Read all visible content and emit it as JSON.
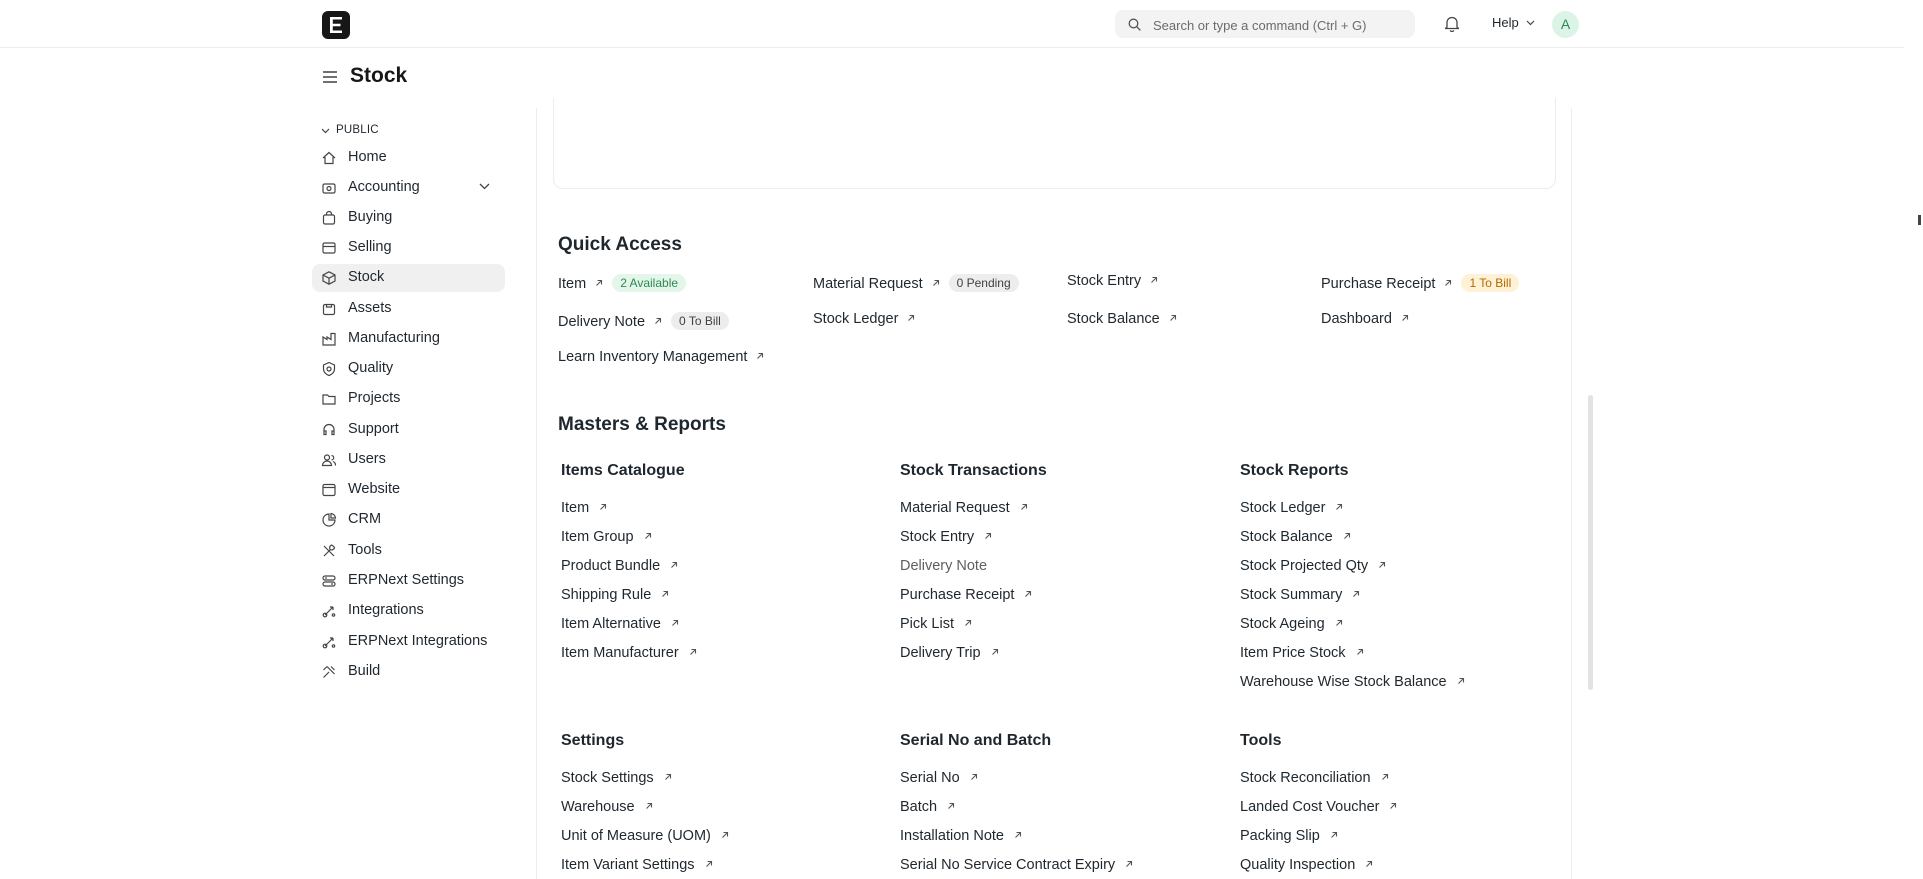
{
  "navbar": {
    "search_placeholder": "Search or type a command (Ctrl + G)",
    "help_label": "Help",
    "avatar_initial": "A"
  },
  "page": {
    "title": "Stock"
  },
  "sidebar": {
    "section_label": "PUBLIC",
    "items": [
      {
        "label": "Home",
        "icon": "home-icon"
      },
      {
        "label": "Accounting",
        "icon": "accounting-icon",
        "expandable": true
      },
      {
        "label": "Buying",
        "icon": "buying-icon"
      },
      {
        "label": "Selling",
        "icon": "selling-icon"
      },
      {
        "label": "Stock",
        "icon": "stock-icon",
        "active": true
      },
      {
        "label": "Assets",
        "icon": "assets-icon"
      },
      {
        "label": "Manufacturing",
        "icon": "manufacturing-icon"
      },
      {
        "label": "Quality",
        "icon": "quality-icon"
      },
      {
        "label": "Projects",
        "icon": "projects-icon"
      },
      {
        "label": "Support",
        "icon": "support-icon"
      },
      {
        "label": "Users",
        "icon": "users-icon"
      },
      {
        "label": "Website",
        "icon": "website-icon"
      },
      {
        "label": "CRM",
        "icon": "crm-icon"
      },
      {
        "label": "Tools",
        "icon": "tools-icon"
      },
      {
        "label": "ERPNext Settings",
        "icon": "settings-icon"
      },
      {
        "label": "Integrations",
        "icon": "integrations-icon"
      },
      {
        "label": "ERPNext Integrations",
        "icon": "integrations-icon"
      },
      {
        "label": "Build",
        "icon": "build-icon"
      }
    ]
  },
  "quick_access": {
    "title": "Quick Access",
    "links": [
      {
        "label": "Item",
        "badge": "2 Available",
        "badge_color": "#2c8a54"
      },
      {
        "label": "Material Request",
        "badge": "0 Pending",
        "badge_color": "#3f3f3f"
      },
      {
        "label": "Stock Entry"
      },
      {
        "label": "Purchase Receipt",
        "badge": "1 To Bill",
        "badge_color": "#b06a00"
      },
      {
        "label": "Delivery Note",
        "badge": "0 To Bill",
        "badge_color": "#3f3f3f"
      },
      {
        "label": "Stock Ledger"
      },
      {
        "label": "Stock Balance"
      },
      {
        "label": "Dashboard"
      },
      {
        "label": "Learn Inventory Management"
      }
    ]
  },
  "masters_reports": {
    "title": "Masters & Reports",
    "cards": [
      {
        "title": "Items Catalogue",
        "links": [
          "Item",
          "Item Group",
          "Product Bundle",
          "Shipping Rule",
          "Item Alternative",
          "Item Manufacturer"
        ]
      },
      {
        "title": "Stock Transactions",
        "links": [
          "Material Request",
          "Stock Entry",
          "Delivery Note",
          "Purchase Receipt",
          "Pick List",
          "Delivery Trip"
        ]
      },
      {
        "title": "Stock Reports",
        "links": [
          "Stock Ledger",
          "Stock Balance",
          "Stock Projected Qty",
          "Stock Summary",
          "Stock Ageing",
          "Item Price Stock",
          "Warehouse Wise Stock Balance"
        ]
      },
      {
        "title": "Settings",
        "links": [
          "Stock Settings",
          "Warehouse",
          "Unit of Measure (UOM)",
          "Item Variant Settings"
        ]
      },
      {
        "title": "Serial No and Batch",
        "links": [
          "Serial No",
          "Batch",
          "Installation Note",
          "Serial No Service Contract Expiry"
        ]
      },
      {
        "title": "Tools",
        "links": [
          "Stock Reconciliation",
          "Landed Cost Voucher",
          "Packing Slip",
          "Quality Inspection"
        ]
      }
    ]
  }
}
